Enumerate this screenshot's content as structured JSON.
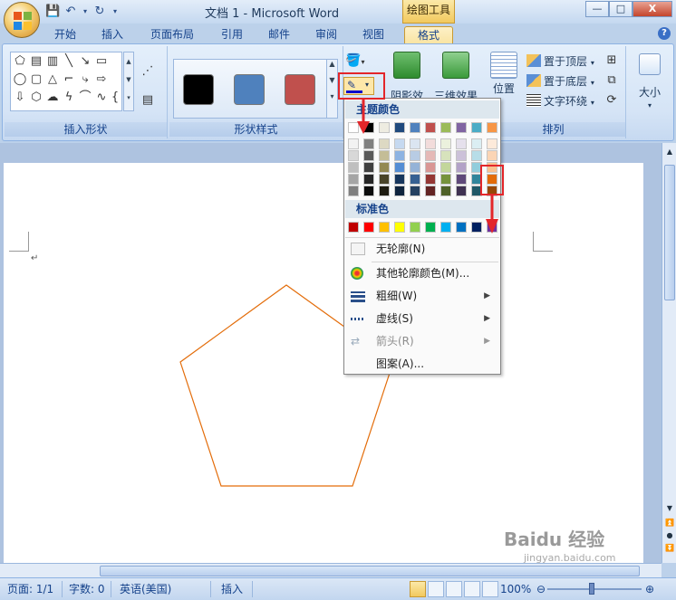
{
  "titlebar": {
    "title": "文档 1 - Microsoft Word",
    "context_tab": "绘图工具",
    "minimize": "—",
    "maximize": "□",
    "close": "X"
  },
  "tabs": [
    {
      "label": "开始"
    },
    {
      "label": "插入"
    },
    {
      "label": "页面布局"
    },
    {
      "label": "引用"
    },
    {
      "label": "邮件"
    },
    {
      "label": "审阅"
    },
    {
      "label": "视图"
    },
    {
      "label": "格式"
    }
  ],
  "help": "?",
  "ribbon": {
    "groups": {
      "insert_shapes": "插入形状",
      "shape_styles": "形状样式",
      "arrange": "排列"
    },
    "shadow_effects": "阴影效果",
    "threed_effects": "三维效果",
    "position": "位置",
    "bring_to_front": "置于顶层",
    "send_to_back": "置于底层",
    "text_wrap": "文字环绕",
    "size": "大小",
    "style_swatches": [
      "#000000",
      "#4f81bd",
      "#c0504d"
    ]
  },
  "menu": {
    "theme_colors_header": "主题颜色",
    "theme_top_row": [
      "#ffffff",
      "#000000",
      "#eeece1",
      "#1f497d",
      "#4f81bd",
      "#c0504d",
      "#9bbb59",
      "#8064a2",
      "#4bacc6",
      "#f79646"
    ],
    "theme_shades": [
      [
        "#f2f2f2",
        "#808080",
        "#ddd9c3",
        "#c6d9f0",
        "#dbe5f1",
        "#f2dcdb",
        "#ebf1dd",
        "#e5e0ec",
        "#dbeef3",
        "#fdeada"
      ],
      [
        "#d8d8d8",
        "#595959",
        "#c4bd97",
        "#8db3e2",
        "#b8cce4",
        "#e5b9b7",
        "#d7e3bc",
        "#ccc1d9",
        "#b7dde8",
        "#fbd5b5"
      ],
      [
        "#bfbfbf",
        "#3f3f3f",
        "#938953",
        "#548dd4",
        "#95b3d7",
        "#d99694",
        "#c3d69b",
        "#b2a2c7",
        "#92cddc",
        "#fac08f"
      ],
      [
        "#a5a5a5",
        "#262626",
        "#494429",
        "#17365d",
        "#366092",
        "#953734",
        "#76923c",
        "#5f497a",
        "#31859b",
        "#e36c09"
      ],
      [
        "#7f7f7f",
        "#0c0c0c",
        "#1d1b10",
        "#0f243e",
        "#244061",
        "#632423",
        "#4f6128",
        "#3f3151",
        "#205867",
        "#974806"
      ]
    ],
    "standard_colors_header": "标准色",
    "standard_colors": [
      "#c00000",
      "#ff0000",
      "#ffc000",
      "#ffff00",
      "#92d050",
      "#00b050",
      "#00b0f0",
      "#0070c0",
      "#002060",
      "#7030a0"
    ],
    "no_outline": "无轮廓(N)",
    "more_colors": "其他轮廓颜色(M)...",
    "weight": "粗细(W)",
    "dashes": "虚线(S)",
    "arrows": "箭头(R)",
    "pattern": "图案(A)..."
  },
  "document": {
    "shape": "pentagon",
    "shape_outline_color": "#e36c09",
    "paragraph_mark": "↵"
  },
  "statusbar": {
    "page": "页面: 1/1",
    "words": "字数: 0",
    "language": "英语(美国)",
    "insert_mode": "插入",
    "zoom": "100%"
  },
  "watermark": {
    "brand": "Baidu 经验",
    "url": "jingyan.baidu.com"
  }
}
